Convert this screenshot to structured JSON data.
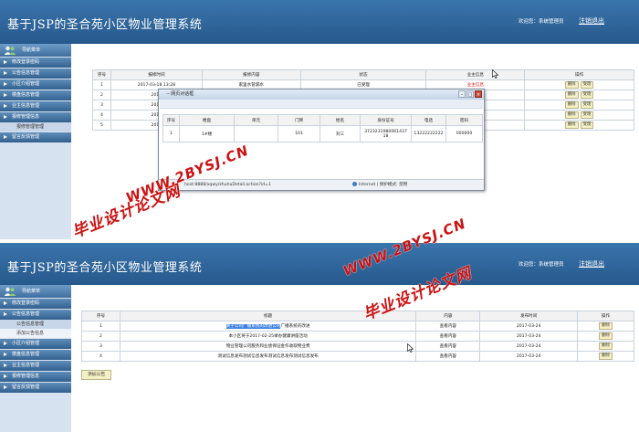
{
  "app": {
    "title": "基于JSP的圣合苑小区物业管理系统",
    "welcome": "欢迎您：系统管理员",
    "logout": "注销退出"
  },
  "panel1": {
    "sidebar": {
      "header": "导航菜单",
      "items": [
        "修改登录密码",
        "公告信息管理",
        "小区介绍管理",
        "楼盘信息管理",
        "业主信息管理",
        "报修管理信息"
      ],
      "sub": [
        "报修管理管理"
      ],
      "last": "留言反馈管理"
    },
    "table": {
      "headers": [
        "序号",
        "报修时间",
        "报修内容",
        "状态",
        "业主信息",
        "操作"
      ],
      "rows": [
        {
          "no": "1",
          "time": "2017-03-18 13:28",
          "content": "家里水管漏水",
          "status": "已受理",
          "owner": "业主信息"
        },
        {
          "no": "2",
          "time": "2017",
          "content": "",
          "status": "",
          "owner": "业主信息"
        },
        {
          "no": "3",
          "time": "2017",
          "content": "",
          "status": "",
          "owner": "业主信息"
        },
        {
          "no": "4",
          "time": "2017",
          "content": "",
          "status": "",
          "owner": "业主信息"
        },
        {
          "no": "5",
          "time": "2017",
          "content": "",
          "status": "",
          "owner": "业主信息"
        }
      ],
      "delete_label": "删除",
      "accept_label": "受理"
    },
    "popup": {
      "title": "-- 网页对话框",
      "headers": [
        "序号",
        "楼盘",
        "单元",
        "门牌",
        "姓名",
        "身份证号",
        "电话",
        "密码"
      ],
      "row": {
        "no": "1",
        "building": "1#楼",
        "unit": "",
        "door": "101",
        "name": "刘三",
        "id_line1": "3723231980061437",
        "id_line2": "18",
        "phone": "13222222222",
        "password": "000000"
      },
      "url": "host:8888/xqwy/zhuhuDetail.action?id=1",
      "zone": "Internet | 保护模式: 禁用"
    }
  },
  "panel2": {
    "sidebar": {
      "header": "导航菜单",
      "top_items": [
        "修改登录密码",
        "公告信息管理"
      ],
      "sub": [
        "公告信息管理",
        "添加公告信息"
      ],
      "items": [
        "小区介绍管理",
        "楼盘信息管理",
        "业主信息管理",
        "报修管理信息",
        "留言反馈管理"
      ]
    },
    "table": {
      "headers": [
        "序号",
        "标题",
        "内容",
        "发布时间",
        "操作"
      ],
      "rows": [
        {
          "no": "1",
          "title_hl": "关于公司广播系统的改进公司",
          "title_rest": "广播系统的改进",
          "content": "查看内容",
          "date": "2017-03-24"
        },
        {
          "no": "2",
          "title_hl": "",
          "title_rest": "本小区将于2017-02-25举办健康讲座活动",
          "content": "查看内容",
          "date": "2017-03-24"
        },
        {
          "no": "3",
          "title_hl": "",
          "title_rest": "物业管理公司服务和业绩保证金作收取物业费",
          "content": "查看内容",
          "date": "2017-03-24"
        },
        {
          "no": "4",
          "title_hl": "",
          "title_rest": "测试信息发布测试信息发布测试信息发布测试信息发布",
          "content": "查看内容",
          "date": "2017-03-24"
        }
      ],
      "delete_label": "删除"
    },
    "add_button": "添加公告"
  },
  "watermarks": {
    "cn": "毕业设计论文网",
    "url": "WWW.2BYSJ.CN"
  }
}
